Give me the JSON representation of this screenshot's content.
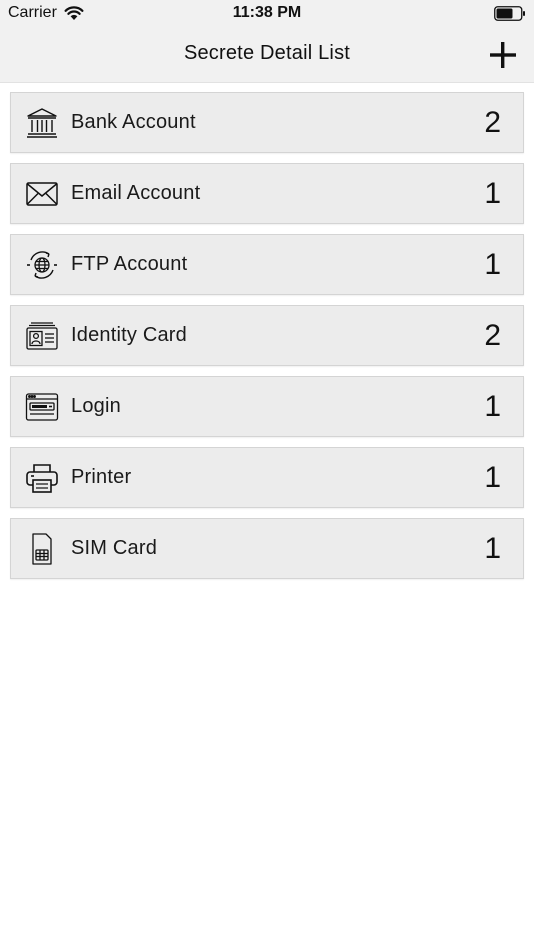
{
  "status_bar": {
    "carrier": "Carrier",
    "time": "11:38 PM",
    "wifi_icon": "wifi-icon",
    "battery_icon": "battery-icon"
  },
  "nav": {
    "title": "Secrete Detail List",
    "add_icon": "plus-icon"
  },
  "items": [
    {
      "label": "Bank Account",
      "count": "2",
      "icon": "bank-icon"
    },
    {
      "label": "Email Account",
      "count": "1",
      "icon": "envelope-icon"
    },
    {
      "label": "FTP Account",
      "count": "1",
      "icon": "globe-sync-icon"
    },
    {
      "label": "Identity Card",
      "count": "2",
      "icon": "id-card-icon"
    },
    {
      "label": "Login",
      "count": "1",
      "icon": "login-window-icon"
    },
    {
      "label": "Printer",
      "count": "1",
      "icon": "printer-icon"
    },
    {
      "label": "SIM Card",
      "count": "1",
      "icon": "sim-card-icon"
    }
  ]
}
